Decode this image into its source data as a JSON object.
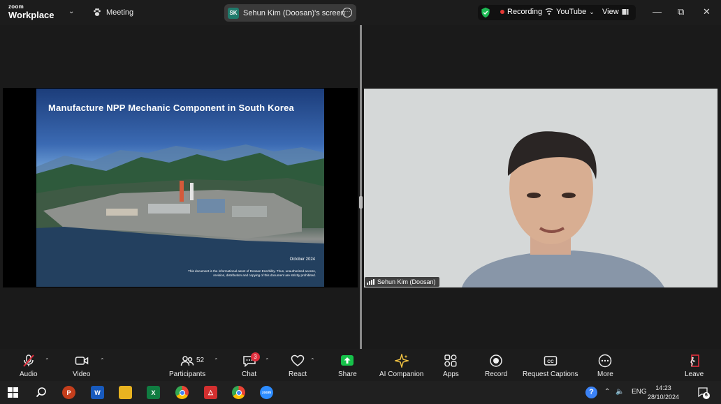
{
  "titlebar": {
    "brand_top": "zoom",
    "brand_bottom": "Workplace",
    "meeting_label": "Meeting",
    "screen_badge": "SK",
    "screen_label": "Sehun Kim (Doosan)'s screen",
    "recording_label": "Recording",
    "youtube_label": "YouTube",
    "view_label": "View",
    "accent_green": "#1db954",
    "recording_dot": "#e53935"
  },
  "slide": {
    "title": "Manufacture NPP Mechanic Component in South Korea",
    "date": "October 2024",
    "legal": "This document is the informational asset of Doosan Enerbility. Thus, unauthorized access, revision, distribution and copying of this document are strictly prohibited."
  },
  "video": {
    "participant_name": "Sehun Kim (Doosan)"
  },
  "toolbar": {
    "audio": "Audio",
    "video": "Video",
    "participants": "Participants",
    "participants_count": "52",
    "chat": "Chat",
    "chat_badge": "3",
    "react": "React",
    "share": "Share",
    "ai_companion": "AI Companion",
    "apps": "Apps",
    "record": "Record",
    "captions": "Request Captions",
    "more": "More",
    "leave": "Leave",
    "share_color": "#16c24a",
    "leave_color": "#e02f3d"
  },
  "taskbar": {
    "language": "ENG",
    "time": "14:23",
    "date": "28/10/2024",
    "notif_count": "6",
    "apps": [
      {
        "name": "PowerPoint",
        "glyph": "P",
        "color": "#c43e1c"
      },
      {
        "name": "Word",
        "glyph": "W",
        "color": "#185abd"
      },
      {
        "name": "File Explorer",
        "glyph": "",
        "color": "#e8b320"
      },
      {
        "name": "Excel",
        "glyph": "X",
        "color": "#107c41"
      },
      {
        "name": "Chrome",
        "glyph": "",
        "color": "#34a853"
      },
      {
        "name": "Acrobat",
        "glyph": "",
        "color": "#d32f2f"
      },
      {
        "name": "Chrome 2",
        "glyph": "",
        "color": "#34a853"
      },
      {
        "name": "Zoom",
        "glyph": "zoom",
        "color": "#2d8cff"
      }
    ]
  }
}
